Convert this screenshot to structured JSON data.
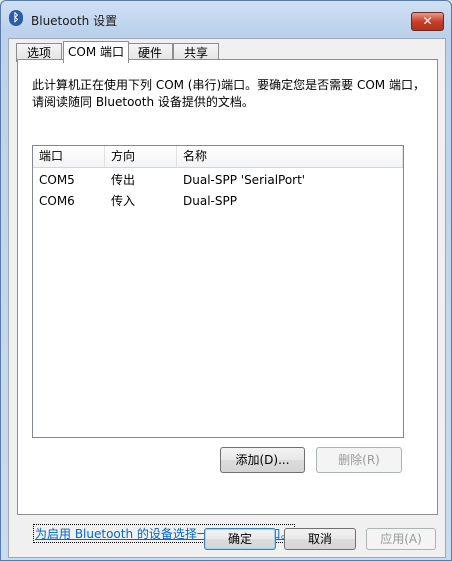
{
  "window": {
    "title": "Bluetooth 设置",
    "close_label": "✕"
  },
  "tabs": [
    {
      "label": "选项",
      "active": false
    },
    {
      "label": "COM 端口",
      "active": true
    },
    {
      "label": "硬件",
      "active": false
    },
    {
      "label": "共享",
      "active": false
    }
  ],
  "description": "此计算机正在使用下列 COM (串行)端口。要确定您是否需要 COM 端口，请阅读随同 Bluetooth 设备提供的文档。",
  "ports_table": {
    "columns": [
      "端口",
      "方向",
      "名称"
    ],
    "rows": [
      [
        "COM5",
        "传出",
        "Dual-SPP 'SerialPort'"
      ],
      [
        "COM6",
        "传入",
        "Dual-SPP"
      ]
    ]
  },
  "buttons": {
    "add": "添加(D)...",
    "remove": "删除(R)",
    "ok": "确定",
    "cancel": "取消",
    "apply": "应用(A)"
  },
  "help_link": "为启用 Bluetooth 的设备选择一个 COM 端口。",
  "colors": {
    "link": "#0066cc",
    "close_button": "#c7402a"
  },
  "icons": {
    "title": "bluetooth-icon",
    "close": "close-icon"
  }
}
